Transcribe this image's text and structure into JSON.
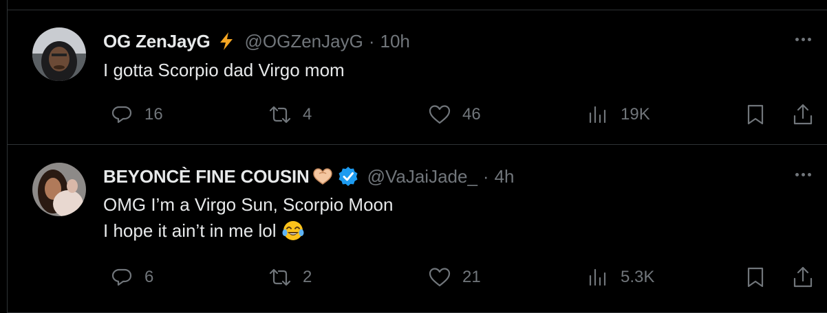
{
  "colors": {
    "background": "#000000",
    "text": "#e7e9ea",
    "muted": "#71767b",
    "divider": "#2f3336",
    "verified": "#1d9bf0",
    "lightning": "#f5a623"
  },
  "tweets": [
    {
      "name": "OG ZenJayG",
      "badge_icon": "lightning-bolt-emoji",
      "handle": "@OGZenJayG",
      "separator": "·",
      "time": "10h",
      "text_lines": [
        "I gotta Scorpio dad Virgo mom"
      ],
      "replies": "16",
      "retweets": "4",
      "likes": "46",
      "views": "19K"
    },
    {
      "name": "BEYONCÈ FINE COUSIN",
      "badge_icon": "heart-hands-emoji",
      "verified": true,
      "handle": "@VaJaiJade_",
      "separator": "·",
      "time": "4h",
      "text_lines": [
        "OMG I’m a Virgo Sun, Scorpio Moon",
        "I hope it ain’t in me lol"
      ],
      "emoji": "tears-of-joy-emoji",
      "replies": "6",
      "retweets": "2",
      "likes": "21",
      "views": "5.3K"
    }
  ]
}
